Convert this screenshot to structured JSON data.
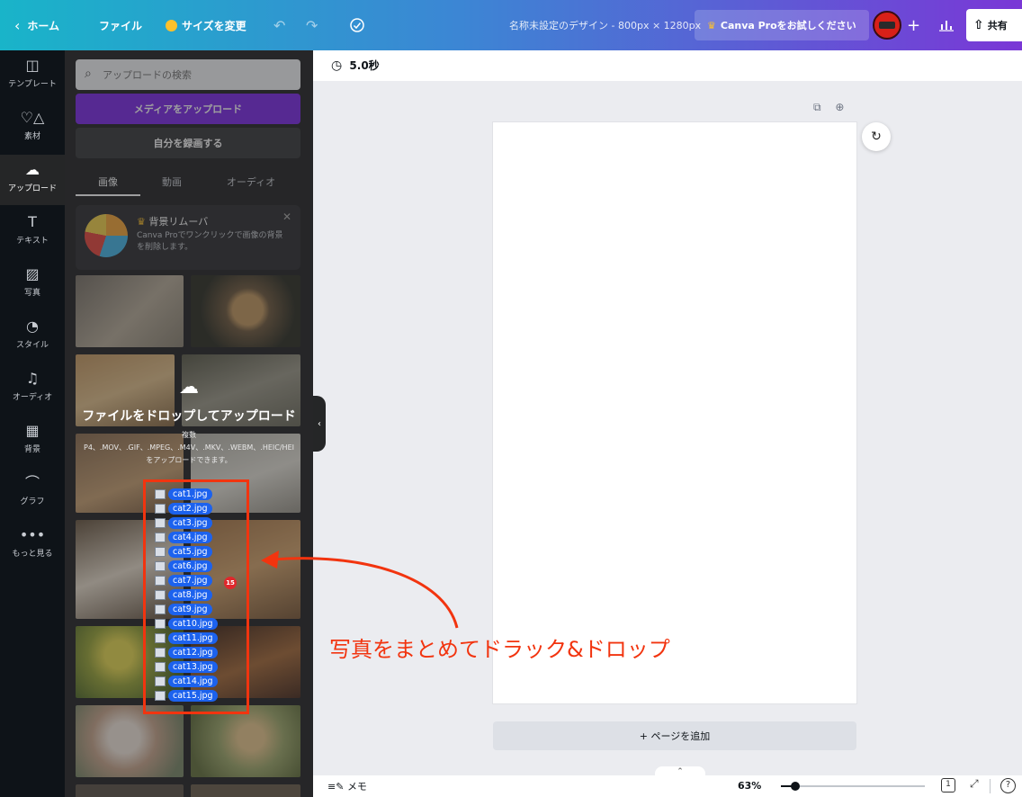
{
  "topbar": {
    "home_label": "ホーム",
    "file_label": "ファイル",
    "resize_label": "サイズを変更",
    "design_title": "名称未設定のデザイン - 800px × 1280px",
    "pro_label": "Canva Proをお試しください",
    "share_label": "共有"
  },
  "rail": {
    "items": [
      {
        "label": "テンプレート",
        "icon": "template-icon"
      },
      {
        "label": "素材",
        "icon": "elements-icon"
      },
      {
        "label": "アップロード",
        "icon": "upload-icon"
      },
      {
        "label": "テキスト",
        "icon": "text-icon"
      },
      {
        "label": "写真",
        "icon": "photo-icon"
      },
      {
        "label": "スタイル",
        "icon": "palette-icon"
      },
      {
        "label": "オーディオ",
        "icon": "music-icon"
      },
      {
        "label": "背景",
        "icon": "background-icon"
      },
      {
        "label": "グラフ",
        "icon": "chart-icon"
      },
      {
        "label": "もっと見る",
        "icon": "more-icon"
      }
    ],
    "active_index": 2
  },
  "panel": {
    "search_placeholder": "アップロードの検索",
    "upload_button": "メディアをアップロード",
    "record_button": "自分を録画する",
    "tabs": [
      "画像",
      "動画",
      "オーディオ"
    ],
    "active_tab": 0,
    "promo": {
      "title": "背景リムーバ",
      "text": "Canva Proでワンクリックで画像の背景を削除します。"
    },
    "drop": {
      "title": "ファイルをドロップしてアップロード",
      "sub1": "複数",
      "sub2": "P4、.MOV、.GIF、.MPEG、.M4V、.MKV、.WEBM、.HEIC/HEI",
      "sub3": "をアップロードできます。"
    }
  },
  "files": [
    "cat1.jpg",
    "cat2.jpg",
    "cat3.jpg",
    "cat4.jpg",
    "cat5.jpg",
    "cat6.jpg",
    "cat7.jpg",
    "cat8.jpg",
    "cat9.jpg",
    "cat10.jpg",
    "cat11.jpg",
    "cat12.jpg",
    "cat13.jpg",
    "cat14.jpg",
    "cat15.jpg"
  ],
  "file_count": "15",
  "annotation": {
    "text": "写真をまとめてドラック&ドロップ",
    "color": "#f2340f"
  },
  "canvas": {
    "duration": "5.0秒",
    "add_page": "+ ページを追加"
  },
  "bottombar": {
    "notes_label": "メモ",
    "zoom": "63%",
    "zoom_fraction": 0.1,
    "page_count": "1"
  },
  "colors": {
    "brand_purple": "#7d2ae8",
    "topbar_start": "#19b4c9",
    "topbar_end": "#7a37d6",
    "chip_blue": "#1c62ee",
    "badge_red": "#e0282c"
  }
}
